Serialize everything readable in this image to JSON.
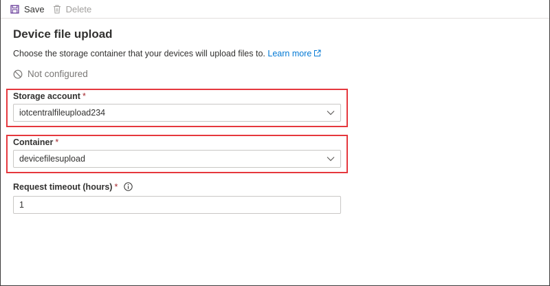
{
  "toolbar": {
    "save_label": "Save",
    "delete_label": "Delete"
  },
  "page": {
    "title": "Device file upload",
    "description": "Choose the storage container that your devices will upload files to.",
    "learn_more": "Learn more",
    "status": "Not configured"
  },
  "form": {
    "storage_account": {
      "label": "Storage account",
      "required_mark": "*",
      "value": "iotcentralfileupload234"
    },
    "container": {
      "label": "Container",
      "required_mark": "*",
      "value": "devicefilesupload"
    },
    "request_timeout": {
      "label": "Request timeout (hours)",
      "required_mark": "*",
      "value": "1"
    }
  },
  "colors": {
    "accent": "#0078d4",
    "highlight": "#e5373d",
    "disabled": "#a19f9d"
  }
}
